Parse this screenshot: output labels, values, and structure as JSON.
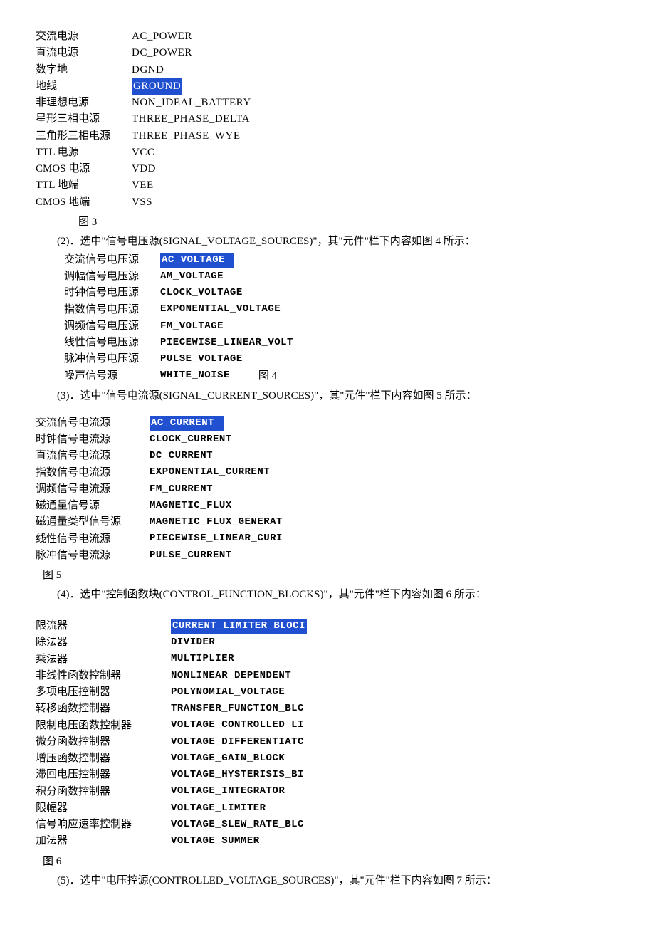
{
  "fig3": {
    "label": "图 3",
    "rows": [
      {
        "cn": "交流电源",
        "en": "AC_POWER",
        "hl": false
      },
      {
        "cn": "直流电源",
        "en": "DC_POWER",
        "hl": false
      },
      {
        "cn": "数字地",
        "en": "DGND",
        "hl": false
      },
      {
        "cn": "地线",
        "en": "GROUND",
        "hl": true
      },
      {
        "cn": "非理想电源",
        "en": "NON_IDEAL_BATTERY",
        "hl": false
      },
      {
        "cn": "星形三相电源",
        "en": "THREE_PHASE_DELTA",
        "hl": false
      },
      {
        "cn": "三角形三相电源",
        "en": "THREE_PHASE_WYE",
        "hl": false
      },
      {
        "cn": "TTL 电源",
        "en": "VCC",
        "hl": false
      },
      {
        "cn": "CMOS 电源",
        "en": "VDD",
        "hl": false
      },
      {
        "cn": "TTL 地端",
        "en": "VEE",
        "hl": false
      },
      {
        "cn": "CMOS 地端",
        "en": "VSS",
        "hl": false
      }
    ]
  },
  "para2": "(2)．选中\"信号电压源(SIGNAL_VOLTAGE_SOURCES)\"，其\"元件\"栏下内容如图 4 所示：",
  "fig4": {
    "label": "图 4",
    "rows": [
      {
        "cn": "交流信号电压源",
        "en": "AC_VOLTAGE",
        "hl": true
      },
      {
        "cn": "调幅信号电压源",
        "en": "AM_VOLTAGE",
        "hl": false
      },
      {
        "cn": "时钟信号电压源",
        "en": "CLOCK_VOLTAGE",
        "hl": false
      },
      {
        "cn": "指数信号电压源",
        "en": "EXPONENTIAL_VOLTAGE",
        "hl": false
      },
      {
        "cn": "调频信号电压源",
        "en": "FM_VOLTAGE",
        "hl": false
      },
      {
        "cn": "线性信号电压源",
        "en": "PIECEWISE_LINEAR_VOLT",
        "hl": false
      },
      {
        "cn": "脉冲信号电压源",
        "en": "PULSE_VOLTAGE",
        "hl": false
      },
      {
        "cn": "噪声信号源",
        "en": "WHITE_NOISE",
        "hl": false
      }
    ]
  },
  "para3": "(3)．选中\"信号电流源(SIGNAL_CURRENT_SOURCES)\"，其\"元件\"栏下内容如图 5 所示：",
  "fig5": {
    "label": "图 5",
    "rows": [
      {
        "cn": "交流信号电流源",
        "en": "AC_CURRENT",
        "hl": true
      },
      {
        "cn": "时钟信号电流源",
        "en": "CLOCK_CURRENT",
        "hl": false
      },
      {
        "cn": "直流信号电流源",
        "en": "DC_CURRENT",
        "hl": false
      },
      {
        "cn": "指数信号电流源",
        "en": "EXPONENTIAL_CURRENT",
        "hl": false
      },
      {
        "cn": "调频信号电流源",
        "en": "FM_CURRENT",
        "hl": false
      },
      {
        "cn": "磁通量信号源",
        "en": "MAGNETIC_FLUX",
        "hl": false
      },
      {
        "cn": "磁通量类型信号源",
        "en": "MAGNETIC_FLUX_GENERAT",
        "hl": false
      },
      {
        "cn": "线性信号电流源",
        "en": "PIECEWISE_LINEAR_CURI",
        "hl": false
      },
      {
        "cn": "脉冲信号电流源",
        "en": "PULSE_CURRENT",
        "hl": false
      }
    ]
  },
  "para4": "(4)．选中\"控制函数块(CONTROL_FUNCTION_BLOCKS)\"，其\"元件\"栏下内容如图 6 所示：",
  "fig6": {
    "label": "图 6",
    "rows": [
      {
        "cn": "限流器",
        "en": "CURRENT_LIMITER_BLOCI",
        "hl": true
      },
      {
        "cn": "除法器",
        "en": "DIVIDER",
        "hl": false
      },
      {
        "cn": "乘法器",
        "en": "MULTIPLIER",
        "hl": false
      },
      {
        "cn": "非线性函数控制器",
        "en": "NONLINEAR_DEPENDENT",
        "hl": false
      },
      {
        "cn": "多项电压控制器",
        "en": "POLYNOMIAL_VOLTAGE",
        "hl": false
      },
      {
        "cn": "转移函数控制器",
        "en": "TRANSFER_FUNCTION_BLC",
        "hl": false
      },
      {
        "cn": "限制电压函数控制器",
        "en": "VOLTAGE_CONTROLLED_LI",
        "hl": false
      },
      {
        "cn": "微分函数控制器",
        "en": "VOLTAGE_DIFFERENTIATC",
        "hl": false
      },
      {
        "cn": "增压函数控制器",
        "en": "VOLTAGE_GAIN_BLOCK",
        "hl": false
      },
      {
        "cn": "滞回电压控制器",
        "en": "VOLTAGE_HYSTERISIS_BI",
        "hl": false
      },
      {
        "cn": "积分函数控制器",
        "en": "VOLTAGE_INTEGRATOR",
        "hl": false
      },
      {
        "cn": "限幅器",
        "en": "VOLTAGE_LIMITER",
        "hl": false
      },
      {
        "cn": "信号响应速率控制器",
        "en": "VOLTAGE_SLEW_RATE_BLC",
        "hl": false
      },
      {
        "cn": "加法器",
        "en": "VOLTAGE_SUMMER",
        "hl": false
      }
    ]
  },
  "para5": "(5)．选中\"电压控源(CONTROLLED_VOLTAGE_SOURCES)\"，其\"元件\"栏下内容如图 7 所示："
}
